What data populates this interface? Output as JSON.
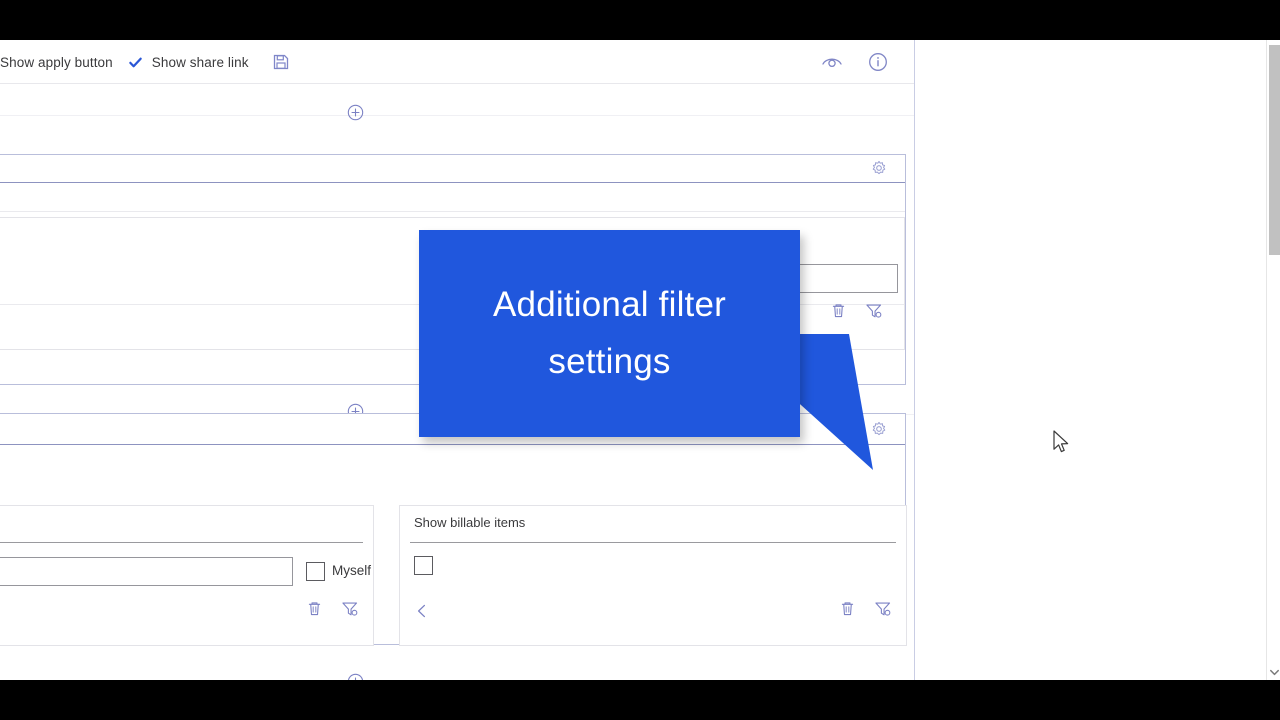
{
  "window": {
    "letterbox_color": "#000000",
    "background": "#ffffff"
  },
  "toolbar": {
    "show_apply_button_label": "Show apply button",
    "show_share_link_label": "Show share link",
    "share_link_checked": true,
    "check_icon": "check-icon",
    "save_icon": "save-floppy-icon",
    "preview_icon": "eye-preview-icon",
    "info_icon": "info-circle-icon"
  },
  "add_buttons": [
    {
      "icon": "plus-circle-icon",
      "name": "add-filter-group-top"
    },
    {
      "icon": "plus-circle-icon",
      "name": "add-filter-group-middle"
    },
    {
      "icon": "plus-circle-icon",
      "name": "add-filter-group-bottom"
    }
  ],
  "groups": [
    {
      "name": "filter-group-1",
      "gear_icon": "gear-settings-icon",
      "tiles": [
        {
          "name": "filter-tile-1",
          "title": "",
          "has_input": true,
          "input_value": "",
          "input_placeholder": "",
          "trash_icon": "trash-icon",
          "filter_settings_icon": "filter-settings-icon"
        }
      ]
    },
    {
      "name": "filter-group-2",
      "gear_icon": "gear-settings-icon",
      "tiles": [
        {
          "name": "filter-tile-user",
          "title": "",
          "has_input": true,
          "input_value": "",
          "input_placeholder": "",
          "checkbox_label": "Myself",
          "checkbox_checked": false,
          "trash_icon": "trash-icon",
          "filter_settings_icon": "filter-settings-icon"
        },
        {
          "name": "filter-tile-billable",
          "title": "Show billable items",
          "checkbox_label": "",
          "checkbox_checked": false,
          "back_icon": "chevron-left-icon",
          "trash_icon": "trash-icon",
          "filter_settings_icon": "filter-settings-icon"
        }
      ]
    }
  ],
  "callout": {
    "text": "Additional filter settings",
    "color": "#2057dd",
    "text_color": "#ffffff",
    "points_to": "gear-settings-icon-group-2"
  },
  "scrollbar": {
    "name": "vertical-scrollbar",
    "thumb_color": "#c1c1c1",
    "down_arrow_icon": "chevron-down-icon"
  },
  "cursor": {
    "icon": "mouse-pointer-icon"
  }
}
